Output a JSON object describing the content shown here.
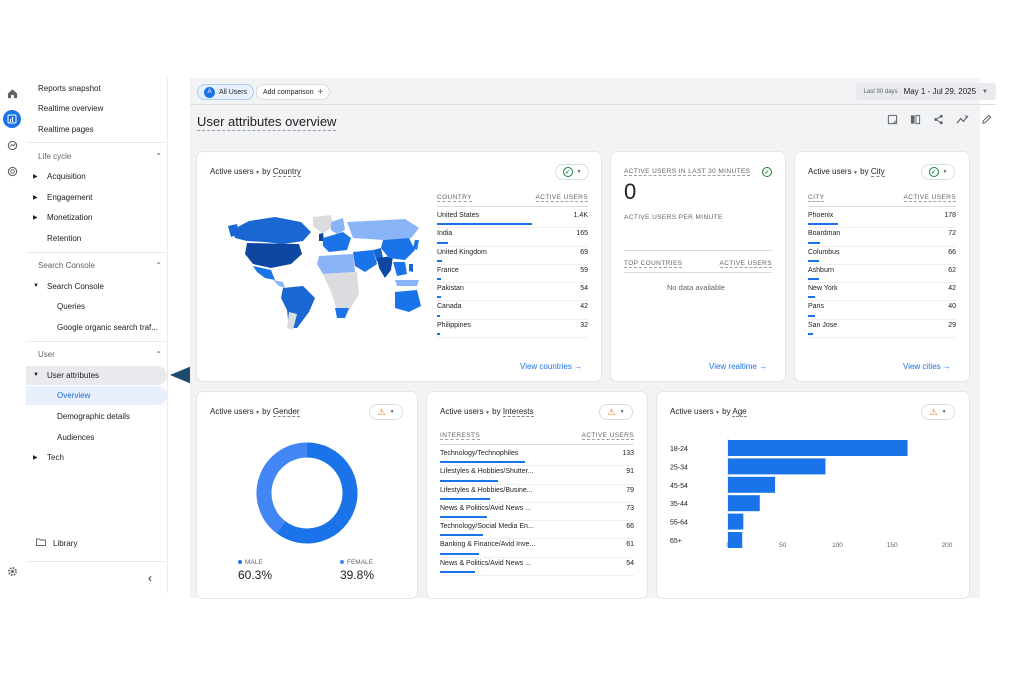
{
  "sidebar": {
    "top_links": [
      "Reports snapshot",
      "Realtime overview",
      "Realtime pages"
    ],
    "lifecycle": {
      "header": "Life cycle",
      "items": [
        "Acquisition",
        "Engagement",
        "Monetization",
        "Retention"
      ]
    },
    "search_console": {
      "header": "Search Console",
      "group": "Search Console",
      "items": [
        "Queries",
        "Google organic search traf..."
      ]
    },
    "user": {
      "header": "User",
      "group": "User attributes",
      "items": [
        "Overview",
        "Demographic details",
        "Audiences"
      ],
      "tech": "Tech"
    },
    "library": "Library",
    "collapse_icon": "chevron-left-icon"
  },
  "header": {
    "comparison_chip": "All Users",
    "comparison_badge": "A",
    "add_comparison": "Add comparison",
    "date_label": "Last 90 days",
    "date_value": "May 1 - Jul 29, 2025",
    "page_title": "User attributes overview"
  },
  "country_card": {
    "title_metric": "Active users",
    "title_by": "by",
    "title_dim": "Country",
    "col1": "COUNTRY",
    "col2": "ACTIVE USERS",
    "rows": [
      {
        "name": "United States",
        "value": "1.4K",
        "frac": 1.0
      },
      {
        "name": "India",
        "value": "165",
        "frac": 0.118
      },
      {
        "name": "United Kingdom",
        "value": "69",
        "frac": 0.05
      },
      {
        "name": "France",
        "value": "59",
        "frac": 0.042
      },
      {
        "name": "Pakistan",
        "value": "54",
        "frac": 0.039
      },
      {
        "name": "Canada",
        "value": "42",
        "frac": 0.03
      },
      {
        "name": "Philippines",
        "value": "32",
        "frac": 0.023
      }
    ],
    "link": "View countries"
  },
  "realtime_card": {
    "label": "ACTIVE USERS IN LAST 30 MINUTES",
    "value": "0",
    "per_minute": "ACTIVE USERS PER MINUTE",
    "col1": "TOP COUNTRIES",
    "col2": "ACTIVE USERS",
    "nodata": "No data available",
    "link": "View realtime"
  },
  "city_card": {
    "title_metric": "Active users",
    "title_by": "by",
    "title_dim": "City",
    "col1": "CITY",
    "col2": "ACTIVE USERS",
    "rows": [
      {
        "name": "Phoenix",
        "value": "178",
        "frac": 1.0
      },
      {
        "name": "Boardman",
        "value": "72",
        "frac": 0.4
      },
      {
        "name": "Columbus",
        "value": "66",
        "frac": 0.37
      },
      {
        "name": "Ashburn",
        "value": "62",
        "frac": 0.35
      },
      {
        "name": "New York",
        "value": "42",
        "frac": 0.24
      },
      {
        "name": "Paris",
        "value": "40",
        "frac": 0.22
      },
      {
        "name": "San Jose",
        "value": "29",
        "frac": 0.16
      }
    ],
    "link": "View cities"
  },
  "gender_card": {
    "title_metric": "Active users",
    "title_by": "by",
    "title_dim": "Gender",
    "male_label": "MALE",
    "male_value": "60.3%",
    "female_label": "FEMALE",
    "female_value": "39.8%",
    "male_fraction": 0.603,
    "male_color": "#1a73e8",
    "female_color": "#4285f4"
  },
  "interests_card": {
    "title_metric": "Active users",
    "title_by": "by",
    "title_dim": "Interests",
    "col1": "INTERESTS",
    "col2": "ACTIVE USERS",
    "rows": [
      {
        "name": "Technology/Technophiles",
        "value": "133",
        "frac": 1.0
      },
      {
        "name": "Lifestyles & Hobbies/Shutter...",
        "value": "91",
        "frac": 0.68
      },
      {
        "name": "Lifestyles & Hobbies/Busine...",
        "value": "79",
        "frac": 0.59
      },
      {
        "name": "News & Politics/Avid News ...",
        "value": "73",
        "frac": 0.55
      },
      {
        "name": "Technology/Social Media En...",
        "value": "66",
        "frac": 0.5
      },
      {
        "name": "Banking & Finance/Avid Inve...",
        "value": "61",
        "frac": 0.46
      },
      {
        "name": "News & Politics/Avid News ...",
        "value": "54",
        "frac": 0.41
      }
    ]
  },
  "age_card": {
    "title_metric": "Active users",
    "title_by": "by",
    "title_dim": "Age"
  },
  "chart_data": {
    "type": "bar",
    "orientation": "horizontal",
    "categories": [
      "18-24",
      "25-34",
      "45-54",
      "35-44",
      "55-64",
      "65+"
    ],
    "values": [
      164,
      89,
      43,
      29,
      14,
      13
    ],
    "xlim": [
      0,
      200
    ],
    "xticks": [
      "0",
      "50",
      "100",
      "150",
      "200"
    ],
    "color": "#1a73e8"
  },
  "colors": {
    "accent": "#1a73e8",
    "map_dark": "#1967d2",
    "map_light": "#8ab4f8",
    "map_none": "#dadce0",
    "warn": "#e37400",
    "ok": "#188038"
  }
}
